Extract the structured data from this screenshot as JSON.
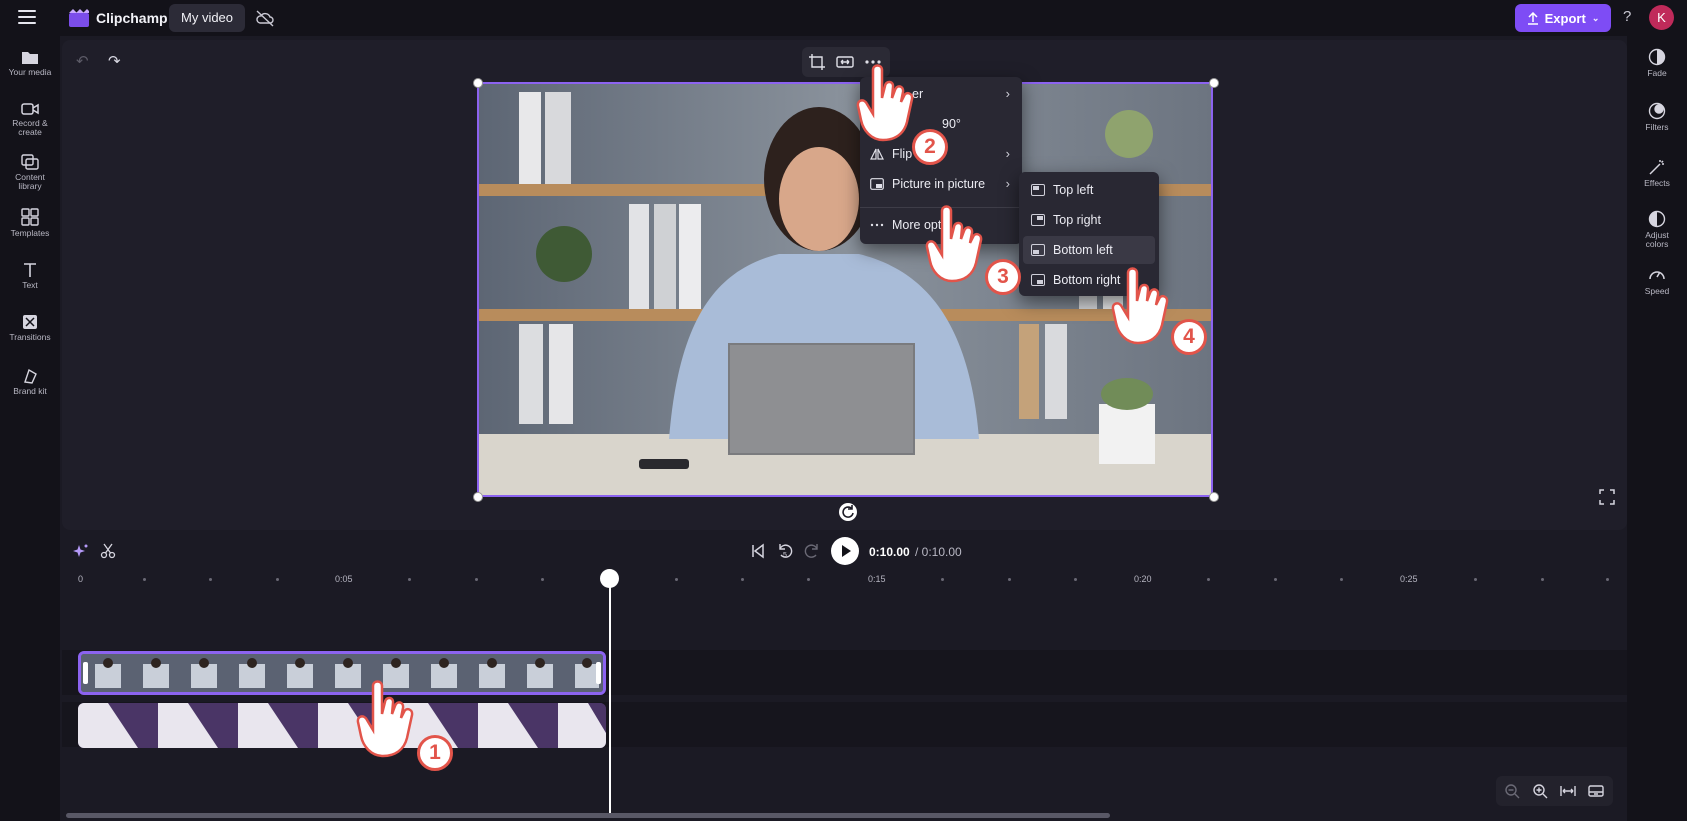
{
  "app": {
    "name": "Clipchamp",
    "document_title": "My video"
  },
  "header": {
    "export_label": "Export",
    "help_label": "?",
    "avatar_initial": "K",
    "accent_color": "#7e4cf5"
  },
  "left_nav": [
    {
      "label": "Your media",
      "icon": "folder-icon"
    },
    {
      "label": "Record &\ncreate",
      "icon": "camera-icon"
    },
    {
      "label": "Content\nlibrary",
      "icon": "library-icon"
    },
    {
      "label": "Templates",
      "icon": "templates-icon"
    },
    {
      "label": "Text",
      "icon": "text-icon"
    },
    {
      "label": "Transitions",
      "icon": "transitions-icon"
    },
    {
      "label": "Brand kit",
      "icon": "brand-kit-icon"
    }
  ],
  "right_panel": [
    {
      "label": "Fade",
      "icon": "fade-icon"
    },
    {
      "label": "Filters",
      "icon": "filters-icon"
    },
    {
      "label": "Effects",
      "icon": "effects-icon"
    },
    {
      "label": "Adjust\ncolors",
      "icon": "adjust-colors-icon"
    },
    {
      "label": "Speed",
      "icon": "speed-icon"
    }
  ],
  "context_menu": {
    "items": [
      {
        "label": "er",
        "has_submenu": true
      },
      {
        "label": "90°",
        "has_submenu": false
      },
      {
        "label": "Flip",
        "has_submenu": true
      },
      {
        "label": "Picture in picture",
        "has_submenu": true
      },
      {
        "label": "More opti",
        "has_submenu": false
      }
    ]
  },
  "pip_submenu": {
    "items": [
      {
        "label": "Top left",
        "highlighted": false
      },
      {
        "label": "Top right",
        "highlighted": false
      },
      {
        "label": "Bottom left",
        "highlighted": true
      },
      {
        "label": "Bottom right",
        "highlighted": false
      }
    ]
  },
  "playback": {
    "current_time": "0:10.00",
    "total_time": "/ 0:10.00"
  },
  "timeline": {
    "ruler_labels": [
      "0",
      "0:05",
      "0:15",
      "0:20",
      "0:25"
    ]
  },
  "annotations": {
    "steps": [
      "1",
      "2",
      "3",
      "4"
    ],
    "badge_color": "#e2544a"
  }
}
